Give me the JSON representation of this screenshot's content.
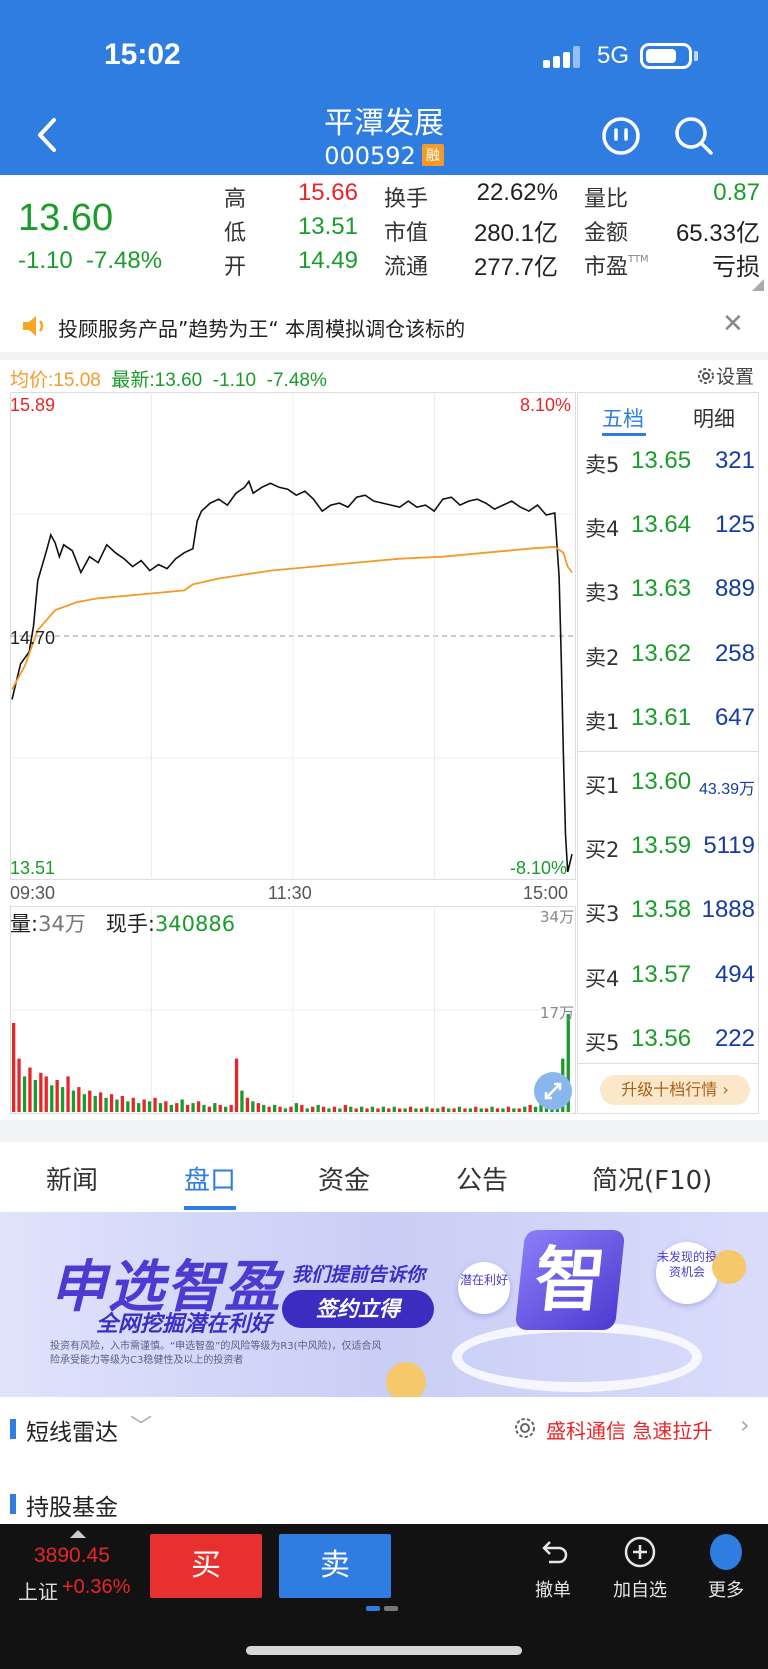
{
  "status_bar": {
    "time": "15:02",
    "network": "5G"
  },
  "header": {
    "stock_name": "平潭发展",
    "stock_code": "000592",
    "badge": "融"
  },
  "quote": {
    "price": "13.60",
    "change": "-1.10",
    "change_pct": "-7.48%",
    "fields": {
      "high_label": "高",
      "high": "15.66",
      "low_label": "低",
      "low": "13.51",
      "open_label": "开",
      "open": "14.49",
      "turnover_label": "换手",
      "turnover": "22.62%",
      "mktcap_label": "市值",
      "mktcap": "280.1亿",
      "float_label": "流通",
      "float": "277.7亿",
      "volratio_label": "量比",
      "volratio": "0.87",
      "amount_label": "金额",
      "amount": "65.33亿",
      "pe_label": "市盈",
      "pe_sup": "TTM",
      "pe": "亏损"
    }
  },
  "notice": {
    "text": "投顾服务产品”趋势为王“ 本周模拟调仓该标的",
    "close": "✕"
  },
  "chart_header": {
    "avg": "均价:15.08",
    "latest": "最新:13.60",
    "chg": "-1.10",
    "pct": "-7.48%",
    "settings": "设置"
  },
  "chart_data": {
    "type": "line",
    "title": "",
    "ylim": [
      13.51,
      15.89
    ],
    "y_labels": {
      "top": "15.89",
      "mid": "14.70",
      "bottom": "13.51"
    },
    "pct_labels": {
      "top": "8.10%",
      "bottom": "-8.10%"
    },
    "x_ticks": [
      "09:30",
      "11:30",
      "15:00"
    ],
    "series": [
      {
        "color": "#111111",
        "points": [
          [
            0,
            14.38
          ],
          [
            2,
            14.56
          ],
          [
            4,
            14.62
          ],
          [
            5,
            14.75
          ],
          [
            6,
            14.98
          ],
          [
            8,
            15.13
          ],
          [
            9,
            15.21
          ],
          [
            10,
            15.17
          ],
          [
            11,
            15.1
          ],
          [
            12,
            15.16
          ],
          [
            14,
            15.13
          ],
          [
            16,
            15.02
          ],
          [
            18,
            15.1
          ],
          [
            20,
            15.07
          ],
          [
            22,
            15.16
          ],
          [
            24,
            15.12
          ],
          [
            26,
            15.09
          ],
          [
            28,
            15.05
          ],
          [
            30,
            15.08
          ],
          [
            32,
            15.03
          ],
          [
            34,
            15.06
          ],
          [
            36,
            15.04
          ],
          [
            38,
            15.09
          ],
          [
            40,
            15.12
          ],
          [
            42,
            15.14
          ],
          [
            43,
            15.28
          ],
          [
            44,
            15.33
          ],
          [
            46,
            15.37
          ],
          [
            48,
            15.39
          ],
          [
            50,
            15.36
          ],
          [
            52,
            15.42
          ],
          [
            54,
            15.45
          ],
          [
            55,
            15.48
          ],
          [
            56,
            15.42
          ],
          [
            58,
            15.45
          ],
          [
            60,
            15.47
          ],
          [
            62,
            15.45
          ],
          [
            64,
            15.44
          ],
          [
            66,
            15.41
          ],
          [
            68,
            15.43
          ],
          [
            70,
            15.39
          ],
          [
            72,
            15.33
          ],
          [
            74,
            15.36
          ],
          [
            76,
            15.37
          ],
          [
            78,
            15.35
          ],
          [
            80,
            15.4
          ],
          [
            82,
            15.41
          ],
          [
            84,
            15.38
          ],
          [
            86,
            15.37
          ],
          [
            88,
            15.36
          ],
          [
            90,
            15.35
          ],
          [
            92,
            15.38
          ],
          [
            94,
            15.35
          ],
          [
            96,
            15.36
          ],
          [
            98,
            15.33
          ],
          [
            100,
            15.39
          ],
          [
            102,
            15.4
          ],
          [
            104,
            15.36
          ],
          [
            106,
            15.38
          ],
          [
            108,
            15.39
          ],
          [
            110,
            15.37
          ],
          [
            112,
            15.34
          ],
          [
            114,
            15.36
          ],
          [
            116,
            15.38
          ],
          [
            118,
            15.35
          ],
          [
            120,
            15.33
          ],
          [
            122,
            15.36
          ],
          [
            124,
            15.31
          ],
          [
            126,
            15.32
          ],
          [
            127,
            15.0
          ],
          [
            127.5,
            14.6
          ],
          [
            128,
            14.1
          ],
          [
            128.5,
            13.7
          ],
          [
            129,
            13.51
          ],
          [
            130,
            13.6
          ]
        ]
      },
      {
        "color": "#f39b2a",
        "points": [
          [
            0,
            14.43
          ],
          [
            3,
            14.55
          ],
          [
            6,
            14.73
          ],
          [
            10,
            14.83
          ],
          [
            15,
            14.87
          ],
          [
            20,
            14.89
          ],
          [
            30,
            14.91
          ],
          [
            40,
            14.93
          ],
          [
            42,
            14.96
          ],
          [
            48,
            14.99
          ],
          [
            60,
            15.03
          ],
          [
            70,
            15.05
          ],
          [
            80,
            15.07
          ],
          [
            90,
            15.09
          ],
          [
            100,
            15.1
          ],
          [
            110,
            15.12
          ],
          [
            120,
            15.14
          ],
          [
            126,
            15.15
          ],
          [
            128,
            15.12
          ],
          [
            129,
            15.05
          ],
          [
            130,
            15.02
          ]
        ]
      }
    ]
  },
  "volume": {
    "label": "量:",
    "value": "34万",
    "hand_label": "现手:",
    "hand": "340886",
    "max": "34万",
    "mid": "17万",
    "bars": [
      [
        0.5,
        "r"
      ],
      [
        0.3,
        "r"
      ],
      [
        0.2,
        "g"
      ],
      [
        0.25,
        "r"
      ],
      [
        0.18,
        "g"
      ],
      [
        0.22,
        "r"
      ],
      [
        0.2,
        "r"
      ],
      [
        0.15,
        "g"
      ],
      [
        0.18,
        "r"
      ],
      [
        0.14,
        "g"
      ],
      [
        0.2,
        "r"
      ],
      [
        0.12,
        "g"
      ],
      [
        0.14,
        "r"
      ],
      [
        0.1,
        "g"
      ],
      [
        0.12,
        "r"
      ],
      [
        0.09,
        "g"
      ],
      [
        0.11,
        "r"
      ],
      [
        0.08,
        "g"
      ],
      [
        0.1,
        "r"
      ],
      [
        0.07,
        "g"
      ],
      [
        0.09,
        "r"
      ],
      [
        0.06,
        "g"
      ],
      [
        0.08,
        "r"
      ],
      [
        0.05,
        "g"
      ],
      [
        0.07,
        "r"
      ],
      [
        0.06,
        "g"
      ],
      [
        0.08,
        "r"
      ],
      [
        0.05,
        "g"
      ],
      [
        0.06,
        "r"
      ],
      [
        0.04,
        "g"
      ],
      [
        0.05,
        "r"
      ],
      [
        0.07,
        "g"
      ],
      [
        0.04,
        "r"
      ],
      [
        0.05,
        "g"
      ],
      [
        0.06,
        "r"
      ],
      [
        0.04,
        "g"
      ],
      [
        0.03,
        "r"
      ],
      [
        0.05,
        "g"
      ],
      [
        0.04,
        "r"
      ],
      [
        0.03,
        "g"
      ],
      [
        0.04,
        "r"
      ],
      [
        0.3,
        "r"
      ],
      [
        0.12,
        "g"
      ],
      [
        0.08,
        "r"
      ],
      [
        0.06,
        "g"
      ],
      [
        0.05,
        "r"
      ],
      [
        0.04,
        "g"
      ],
      [
        0.03,
        "r"
      ],
      [
        0.04,
        "g"
      ],
      [
        0.03,
        "r"
      ],
      [
        0.02,
        "g"
      ],
      [
        0.03,
        "r"
      ],
      [
        0.05,
        "g"
      ],
      [
        0.04,
        "r"
      ],
      [
        0.02,
        "g"
      ],
      [
        0.03,
        "r"
      ],
      [
        0.04,
        "g"
      ],
      [
        0.03,
        "r"
      ],
      [
        0.02,
        "g"
      ],
      [
        0.03,
        "r"
      ],
      [
        0.02,
        "g"
      ],
      [
        0.04,
        "r"
      ],
      [
        0.03,
        "g"
      ],
      [
        0.02,
        "r"
      ],
      [
        0.03,
        "g"
      ],
      [
        0.02,
        "r"
      ],
      [
        0.03,
        "g"
      ],
      [
        0.02,
        "r"
      ],
      [
        0.03,
        "g"
      ],
      [
        0.02,
        "r"
      ],
      [
        0.03,
        "g"
      ],
      [
        0.02,
        "r"
      ],
      [
        0.02,
        "g"
      ],
      [
        0.03,
        "r"
      ],
      [
        0.02,
        "g"
      ],
      [
        0.02,
        "r"
      ],
      [
        0.03,
        "g"
      ],
      [
        0.02,
        "r"
      ],
      [
        0.02,
        "g"
      ],
      [
        0.03,
        "r"
      ],
      [
        0.02,
        "g"
      ],
      [
        0.02,
        "r"
      ],
      [
        0.03,
        "g"
      ],
      [
        0.02,
        "r"
      ],
      [
        0.02,
        "g"
      ],
      [
        0.03,
        "r"
      ],
      [
        0.02,
        "g"
      ],
      [
        0.02,
        "r"
      ],
      [
        0.03,
        "g"
      ],
      [
        0.02,
        "r"
      ],
      [
        0.02,
        "g"
      ],
      [
        0.03,
        "r"
      ],
      [
        0.02,
        "g"
      ],
      [
        0.02,
        "r"
      ],
      [
        0.03,
        "g"
      ],
      [
        0.04,
        "r"
      ],
      [
        0.03,
        "g"
      ],
      [
        0.05,
        "g"
      ],
      [
        0.08,
        "g"
      ],
      [
        0.14,
        "g"
      ],
      [
        0.2,
        "g"
      ],
      [
        0.3,
        "g"
      ],
      [
        0.55,
        "g"
      ]
    ]
  },
  "order_book": {
    "tabs": [
      "五档",
      "明细"
    ],
    "sell": [
      {
        "label": "卖5",
        "price": "13.65",
        "vol": "321"
      },
      {
        "label": "卖4",
        "price": "13.64",
        "vol": "125"
      },
      {
        "label": "卖3",
        "price": "13.63",
        "vol": "889"
      },
      {
        "label": "卖2",
        "price": "13.62",
        "vol": "258"
      },
      {
        "label": "卖1",
        "price": "13.61",
        "vol": "647"
      }
    ],
    "buy": [
      {
        "label": "买1",
        "price": "13.60",
        "vol": "43.39万"
      },
      {
        "label": "买2",
        "price": "13.59",
        "vol": "5119"
      },
      {
        "label": "买3",
        "price": "13.58",
        "vol": "1888"
      },
      {
        "label": "买4",
        "price": "13.57",
        "vol": "494"
      },
      {
        "label": "买5",
        "price": "13.56",
        "vol": "222"
      }
    ],
    "upgrade": "升级十档行情 ›"
  },
  "tabs": [
    "新闻",
    "盘口",
    "资金",
    "公告",
    "简况(F10)"
  ],
  "banner": {
    "title": "申选智盈",
    "subtitle": "全网挖掘潜在利好",
    "tag": "我们提前告诉你",
    "cta": "签约立得",
    "disclaimer": "投资有风险，入市需谨慎。“申选智盈”的风险等级为R3(中风险)，仅适合风险承受能力等级为C3稳健性及以上的投资者",
    "bubble1": "潜在利好",
    "zhi": "智",
    "bubble2": "未发现的投资机会"
  },
  "radar": {
    "title": "短线雷达",
    "chevron": "﹀",
    "news": "盛科通信 急速拉升",
    "arrow": "›"
  },
  "funds": {
    "title": "持股基金"
  },
  "bottom_bar": {
    "index_value": "3890.45",
    "index_name": "上证",
    "index_change": "+0.36%",
    "buy": "买",
    "sell": "卖",
    "undo": "撤单",
    "add": "加自选",
    "more": "更多"
  },
  "colors": {
    "header": "#2f7de1",
    "up": "#e8262a",
    "down": "#1a9c2b",
    "avg": "#f39b2a"
  }
}
